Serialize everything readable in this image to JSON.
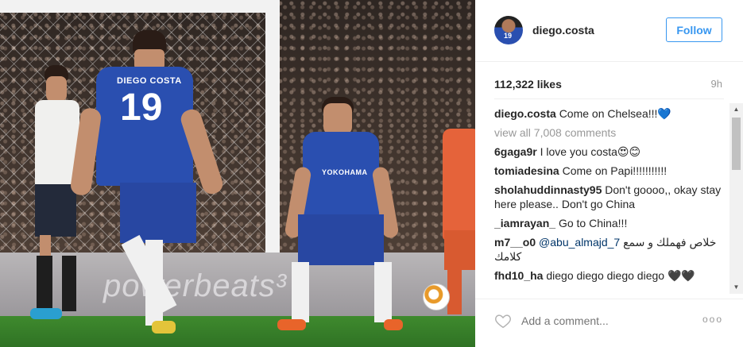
{
  "post": {
    "username": "diego.costa",
    "follow_label": "Follow",
    "likes": "112,322 likes",
    "time": "9h",
    "add_comment_placeholder": "Add a comment...",
    "more_glyph": "ooo"
  },
  "photo": {
    "player_name": "DIEGO COSTA",
    "shirt_number": "19",
    "ad_text": "powerbeats³",
    "sponsor": "YOKOHAMA",
    "avatar_number": "19"
  },
  "comments": {
    "caption_user": "diego.costa",
    "caption_text": "Come on Chelsea!!!💙",
    "view_all": "view all 7,008 comments",
    "items": [
      {
        "user": "6gaga9r",
        "text": "I love you costa😍😊"
      },
      {
        "user": "tomiadesina",
        "text": "Come on Papi!!!!!!!!!!!"
      },
      {
        "user": "sholahuddinnasty95",
        "text": "Don't goooo,, okay stay here please.. Don't go China"
      },
      {
        "user": "_iamrayan_",
        "text": "Go to China!!!"
      },
      {
        "user": "m7__o0",
        "mention": "@abu_almajd_7",
        "text": "خلاص فهملك و سمع كلامك"
      },
      {
        "user": "fhd10_ha",
        "text": "diego diego diego diego 🖤🖤"
      }
    ]
  },
  "colors": {
    "accent": "#3897f0",
    "text": "#262626",
    "muted": "#999999",
    "chelsea_blue": "#2a4fb0"
  },
  "icons": {
    "like": "heart-icon",
    "more": "more-options-icon",
    "scroll_up": "scroll-up-arrow-icon",
    "scroll_down": "scroll-down-arrow-icon"
  }
}
